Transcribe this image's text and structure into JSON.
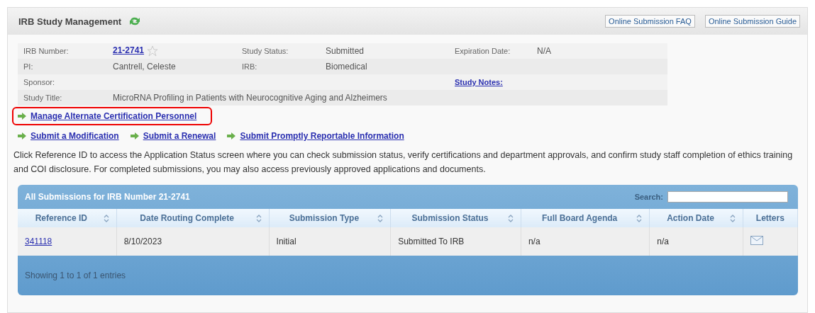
{
  "header": {
    "title": "IRB Study Management",
    "buttons": [
      "Online Submission FAQ",
      "Online Submission Guide"
    ]
  },
  "info": [
    {
      "label": "IRB Number:",
      "value_link": "21-2741",
      "starred": false,
      "label2": "Study Status:",
      "value2": "Submitted",
      "label3": "Expiration Date:",
      "value3": "N/A"
    },
    {
      "label": "PI:",
      "value": "Cantrell, Celeste",
      "label2": "IRB:",
      "value2": "Biomedical"
    },
    {
      "label": "Sponsor:",
      "notes_link": "Study Notes:"
    },
    {
      "label": "Study Title:",
      "title_value": "MicroRNA Profiling in Patients with  Neurocognitive Aging and Alzheimers"
    }
  ],
  "highlighted_link": {
    "label": "Manage Alternate Certification Personnel",
    "highlighted": true
  },
  "links": [
    "Submit a Modification",
    "Submit a Renewal",
    "Submit Promptly Reportable Information"
  ],
  "description": "Click Reference ID to access the Application Status screen where you can check submission status, verify certifications and department approvals, and confirm study staff completion of ethics training and COI disclosure. For completed submissions, you may also access previously approved applications and documents.",
  "grid": {
    "title": "All Submissions for IRB Number 21-2741",
    "search_label": "Search:",
    "columns": [
      {
        "label": "Reference ID",
        "sortable": true
      },
      {
        "label": "Date Routing Complete",
        "sortable": true
      },
      {
        "label": "Submission Type",
        "sortable": true
      },
      {
        "label": "Submission Status",
        "sortable": true
      },
      {
        "label": "Full Board Agenda",
        "sortable": true
      },
      {
        "label": "Action Date",
        "sortable": true
      },
      {
        "label": "Letters",
        "sortable": false
      }
    ],
    "rows": [
      {
        "reference_id": "341118",
        "date_routing_complete": "8/10/2023",
        "submission_type": "Initial",
        "submission_status": "Submitted To IRB",
        "full_board_agenda": "n/a",
        "action_date": "n/a"
      }
    ],
    "footer": "Showing 1 to 1 of 1 entries"
  }
}
